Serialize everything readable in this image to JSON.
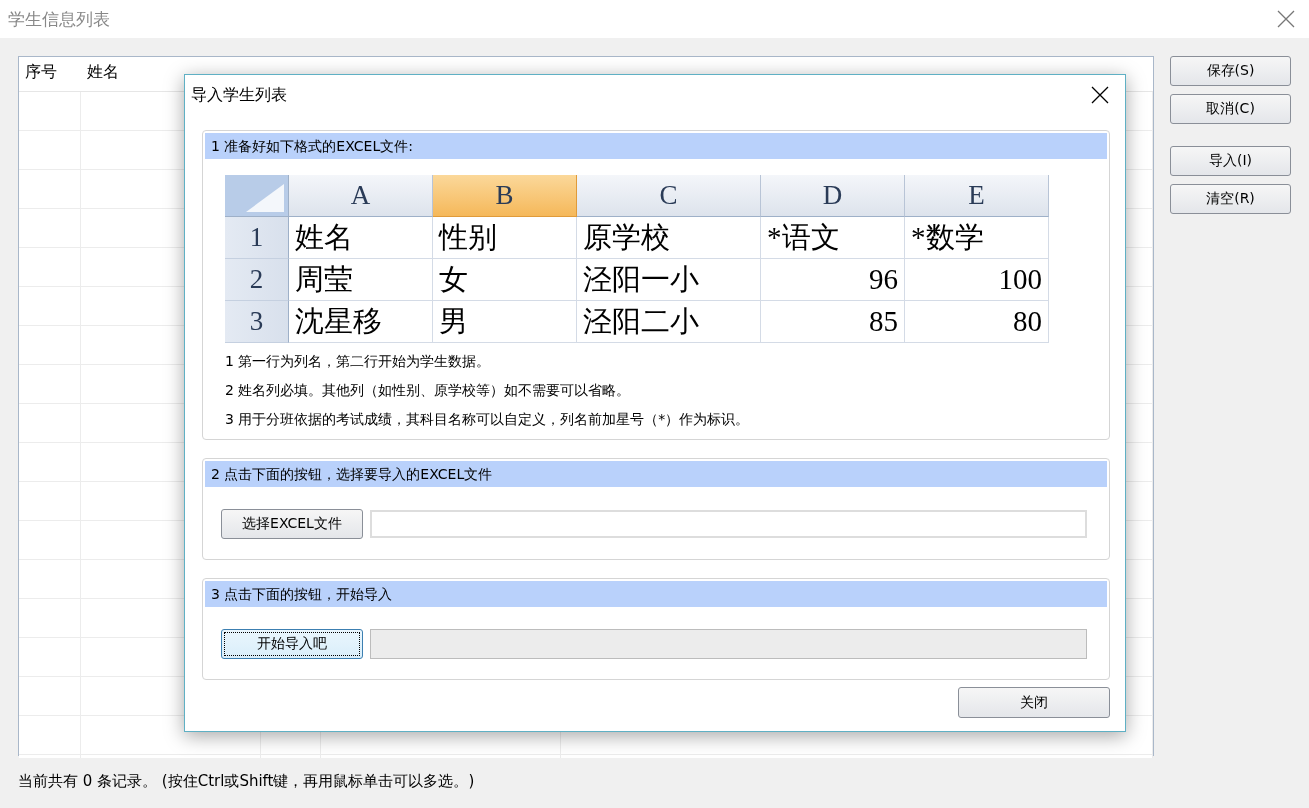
{
  "window": {
    "title": "学生信息列表"
  },
  "list": {
    "columns": [
      "序号",
      "姓名"
    ]
  },
  "side_button_groups": [
    [
      "保存(S)",
      "取消(C)"
    ],
    [
      "导入(I)",
      "清空(R)"
    ]
  ],
  "status_bar": {
    "text": "当前共有 0 条记录。 (按住Ctrl或Shift键，再用鼠标单击可以多选。)"
  },
  "dialog": {
    "title": "导入学生列表",
    "sections": [
      {
        "kind": "sample",
        "heading": "1 准备好如下格式的EXCEL文件:",
        "sheet": {
          "columns": [
            {
              "label": "A",
              "selected": false,
              "numeric": false
            },
            {
              "label": "B",
              "selected": true,
              "numeric": false
            },
            {
              "label": "C",
              "selected": false,
              "numeric": false
            },
            {
              "label": "D",
              "selected": false,
              "numeric": true
            },
            {
              "label": "E",
              "selected": false,
              "numeric": true
            }
          ],
          "rows": [
            {
              "number": "1",
              "kind": "names",
              "cells": [
                "姓名",
                "性别",
                "原学校",
                "*语文",
                "*数学"
              ]
            },
            {
              "number": "2",
              "kind": "data",
              "cells": [
                "周莹",
                "女",
                "泾阳一小",
                "96",
                "100"
              ]
            },
            {
              "number": "3",
              "kind": "data",
              "cells": [
                "沈星移",
                "男",
                "泾阳二小",
                "85",
                "80"
              ]
            }
          ]
        },
        "notes": [
          "1 第一行为列名，第二行开始为学生数据。",
          "2 姓名列必填。其他列（如性别、原学校等）如不需要可以省略。",
          "3 用于分班依据的考试成绩，其科目名称可以自定义，列名前加星号（*）作为标识。"
        ]
      },
      {
        "kind": "file",
        "heading": "2 点击下面的按钮，选择要导入的EXCEL文件",
        "button": "选择EXCEL文件",
        "focused": false
      },
      {
        "kind": "progress",
        "heading": "3 点击下面的按钮，开始导入",
        "button": "开始导入吧",
        "focused": true,
        "level": 0
      }
    ],
    "close_button": "关闭"
  }
}
